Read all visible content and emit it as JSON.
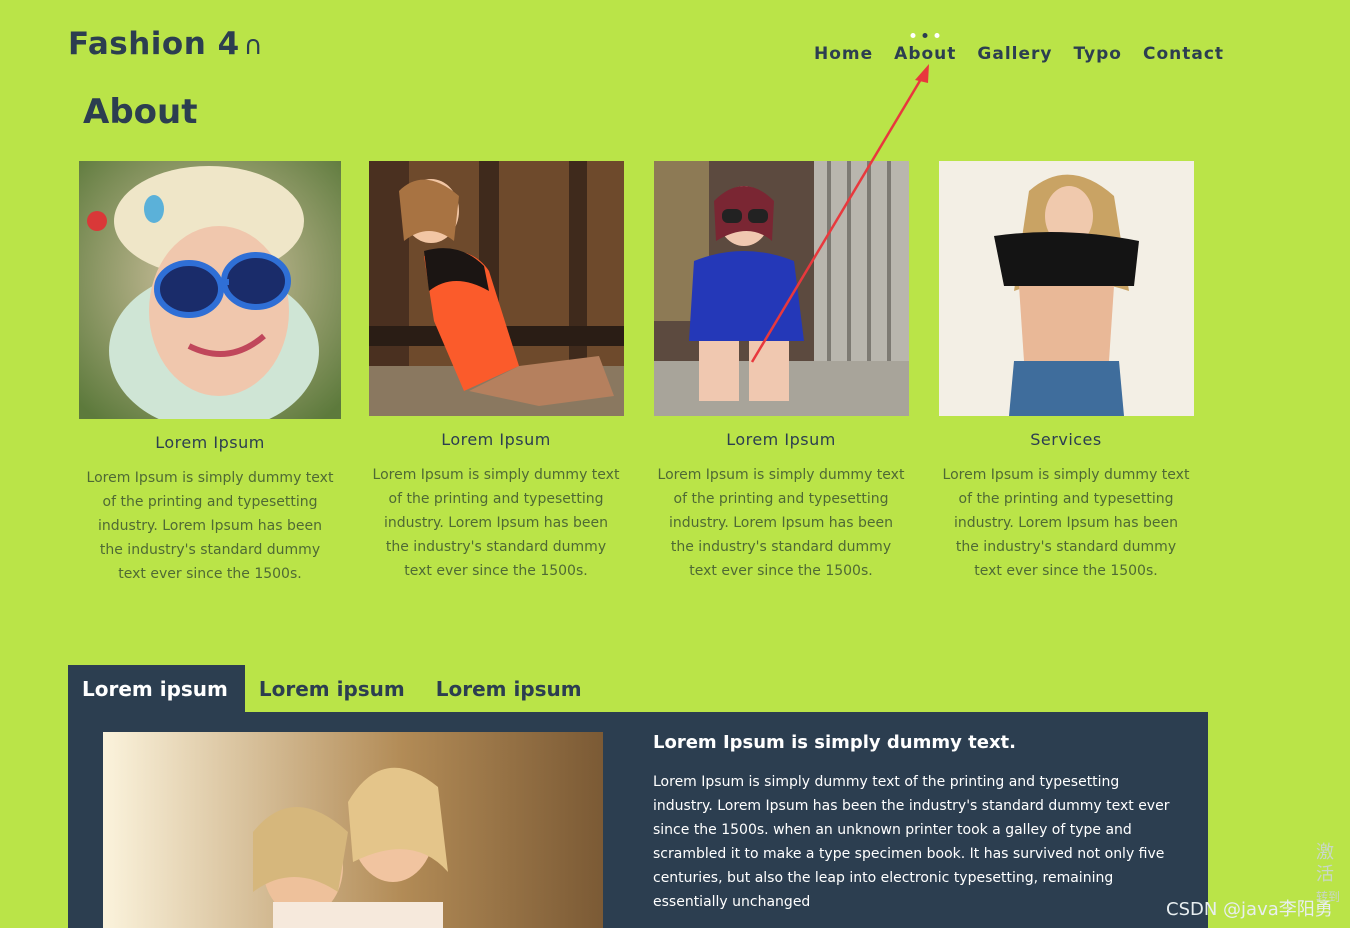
{
  "header": {
    "logo_text": "Fashion 4",
    "logo_mark": "∩",
    "nav": [
      {
        "label": "Home"
      },
      {
        "label": "About"
      },
      {
        "label": "Gallery"
      },
      {
        "label": "Typo"
      },
      {
        "label": "Contact"
      }
    ]
  },
  "page_title": "About",
  "cards": [
    {
      "title": "Lorem Ipsum",
      "text": "Lorem Ipsum is simply dummy text of the printing and typesetting industry. Lorem Ipsum has been the industry's standard dummy text ever since the 1500s.",
      "photo": "woman-blue-sunglasses-photo"
    },
    {
      "title": "Lorem Ipsum",
      "text": "Lorem Ipsum is simply dummy text of the printing and typesetting industry. Lorem Ipsum has been the industry's standard dummy text ever since the 1500s.",
      "photo": "woman-orange-top-photo"
    },
    {
      "title": "Lorem Ipsum",
      "text": "Lorem Ipsum is simply dummy text of the printing and typesetting industry. Lorem Ipsum has been the industry's standard dummy text ever since the 1500s.",
      "photo": "woman-blue-dress-photo"
    },
    {
      "title": "Services",
      "text": "Lorem Ipsum is simply dummy text of the printing and typesetting industry. Lorem Ipsum has been the industry's standard dummy text ever since the 1500s.",
      "photo": "woman-black-top-photo"
    }
  ],
  "tabs": [
    {
      "label": "Lorem ipsum",
      "active": true
    },
    {
      "label": "Lorem ipsum",
      "active": false
    },
    {
      "label": "Lorem ipsum",
      "active": false
    }
  ],
  "panel": {
    "title": "Lorem Ipsum is simply dummy text.",
    "text": "Lorem Ipsum is simply dummy text of the printing and typesetting industry. Lorem Ipsum has been the industry's standard dummy text ever since the 1500s. when an unknown printer took a galley of type and scrambled it to make a type specimen book. It has survived not only five centuries, but also the leap into electronic typesetting, remaining essentially unchanged"
  },
  "watermark": "CSDN @java李阳勇",
  "side_text": {
    "line1": "激活",
    "line2": "转到"
  },
  "colors": {
    "background": "#bae448",
    "primary": "#2c3e50",
    "annotation_arrow": "#e8383d"
  }
}
